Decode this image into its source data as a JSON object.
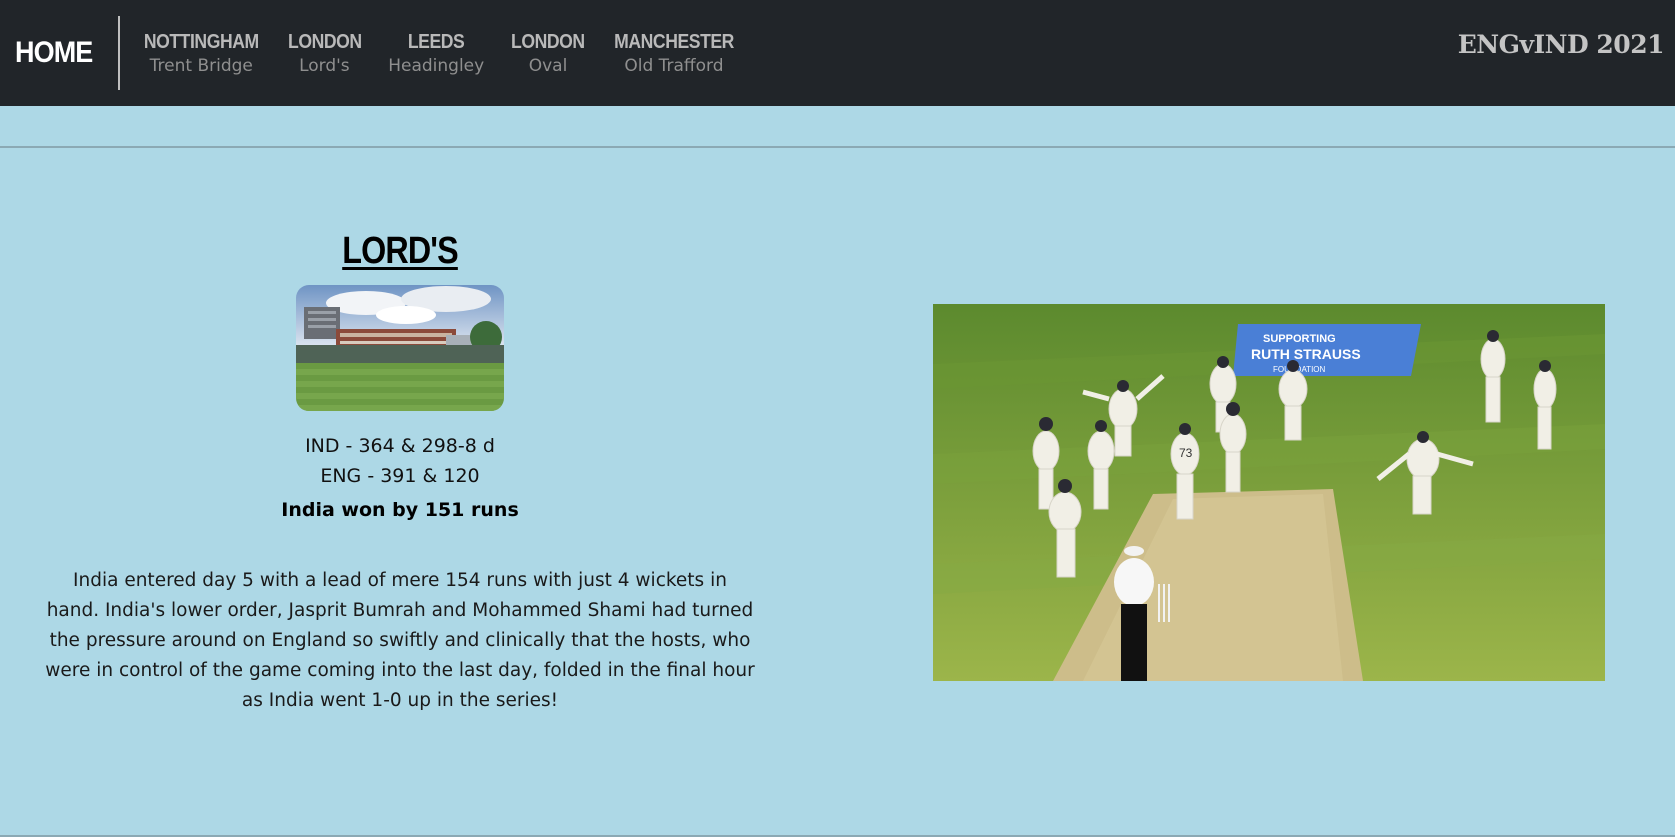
{
  "nav": {
    "home_label": "HOME",
    "venues": [
      {
        "city": "NOTTINGHAM",
        "ground": "Trent Bridge"
      },
      {
        "city": "LONDON",
        "ground": "Lord's"
      },
      {
        "city": "LEEDS",
        "ground": "Headingley"
      },
      {
        "city": "LONDON",
        "ground": "Oval"
      },
      {
        "city": "MANCHESTER",
        "ground": "Old Trafford"
      }
    ],
    "brand": "ENGvIND 2021"
  },
  "main": {
    "title": "LORD'S",
    "score_ind": "IND - 364 & 298-8 d",
    "score_eng": "ENG - 391 & 120",
    "result": "India won by 151 runs",
    "summary": "India entered day 5 with a lead of mere 154 runs with just 4 wickets in hand. India's lower order, Jasprit Bumrah and Mohammed Shami had turned the pressure around on England so swiftly and clinically that the hosts, who were in control of the game coming into the last day, folded in the final hour as India went 1-0 up in the series!"
  },
  "photo": {
    "banner_top": "SUPPORTING",
    "banner_mid": "RUTH STRAUSS",
    "banner_bot": "FOUNDATION",
    "jersey_number": "73"
  }
}
